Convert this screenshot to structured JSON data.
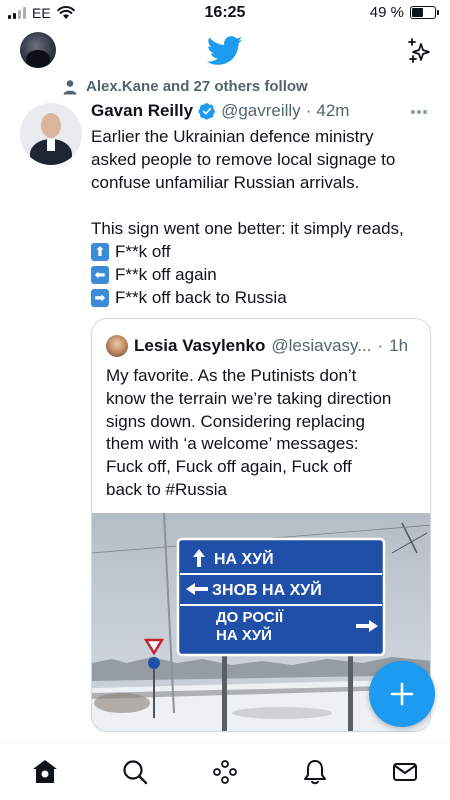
{
  "status_bar": {
    "carrier": "EE",
    "time": "16:25",
    "battery": "49 %",
    "battery_level": 0.49
  },
  "top_nav": {
    "logo": "twitter-bird-icon",
    "timeline_icon": "sparkle-icon"
  },
  "social_context": {
    "text": "Alex.Kane and 27 others follow"
  },
  "tweet": {
    "author_name": "Gavan Reilly",
    "handle": "@gavreilly",
    "separator": "·",
    "time": "42m",
    "text_lines": [
      "Earlier the Ukrainian defence ministry",
      "asked people to remove local signage to",
      "confuse unfamiliar Russian arrivals."
    ],
    "text_line_4": "This sign went one better: it simply reads,",
    "sign_lines": [
      {
        "arrow": "⬆",
        "text": "F**k off"
      },
      {
        "arrow": "⬅",
        "text": "F**k off again"
      },
      {
        "arrow": "➡",
        "text": "F**k off back to Russia"
      }
    ]
  },
  "quote": {
    "author_name": "Lesia Vasylenko",
    "handle": "@lesiavasy...",
    "separator": "·",
    "time": "1h",
    "text_lines": [
      "My favorite. As the Putinists don’t",
      "know the terrain we’re taking direction",
      "signs down. Considering replacing",
      "them with ‘a welcome’ messages:",
      "Fuck off, Fuck off again, Fuck off",
      "back to #Russia"
    ],
    "sign": {
      "row1": "НА ХУЙ",
      "row2": "ЗНОВ НА ХУЙ",
      "row3a": "ДО РОСІЇ",
      "row3b": "НА ХУЙ"
    }
  },
  "fab": {
    "label": "+"
  },
  "bottom_nav": [
    "home-icon",
    "search-icon",
    "spaces-icon",
    "notifications-icon",
    "messages-icon"
  ],
  "colors": {
    "accent": "#1d9bf0",
    "sign_blue": "#1f4fa8",
    "text_primary": "#0f1419",
    "text_secondary": "#536471"
  }
}
